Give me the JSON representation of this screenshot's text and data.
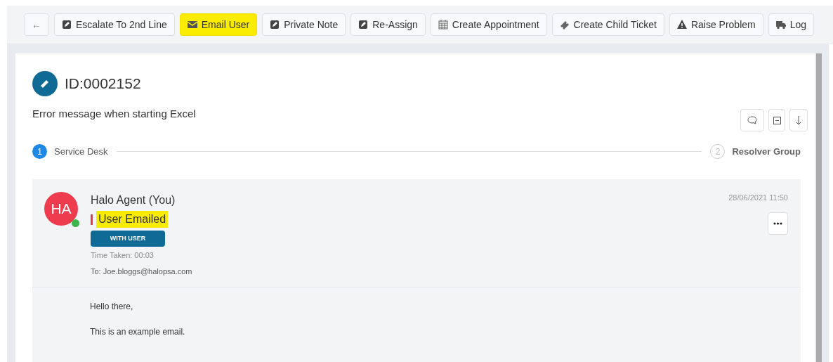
{
  "toolbar": [
    {
      "kind": "back",
      "label": "←",
      "selected": false
    },
    {
      "kind": "edit",
      "label": "Escalate To 2nd Line",
      "selected": false
    },
    {
      "kind": "mail",
      "label": "Email User",
      "selected": true
    },
    {
      "kind": "edit",
      "label": "Private Note",
      "selected": false
    },
    {
      "kind": "edit",
      "label": "Re-Assign",
      "selected": false
    },
    {
      "kind": "calendar",
      "label": "Create Appointment",
      "selected": false
    },
    {
      "kind": "ticket",
      "label": "Create Child Ticket",
      "selected": false
    },
    {
      "kind": "warning",
      "label": "Raise Problem",
      "selected": false
    },
    {
      "kind": "truck",
      "label": "Log",
      "selected": false
    }
  ],
  "ticket": {
    "id": "ID:0002152",
    "summary": "Error message when starting Excel"
  },
  "steps": [
    {
      "number": "1",
      "label": "Service Desk",
      "selected": true
    },
    {
      "number": "2",
      "label": "Resolver Group",
      "selected": false
    }
  ],
  "action": {
    "avatar": "HA",
    "online": true,
    "author": "Halo Agent (You)",
    "title": "User Emailed",
    "status": "WITH USER",
    "time_taken": "Time Taken: 00:03",
    "to": "To: Joe.bloggs@halopsa.com",
    "date": "28/06/2021 11:50",
    "body": [
      "Hello there,",
      "This is an example email."
    ]
  }
}
